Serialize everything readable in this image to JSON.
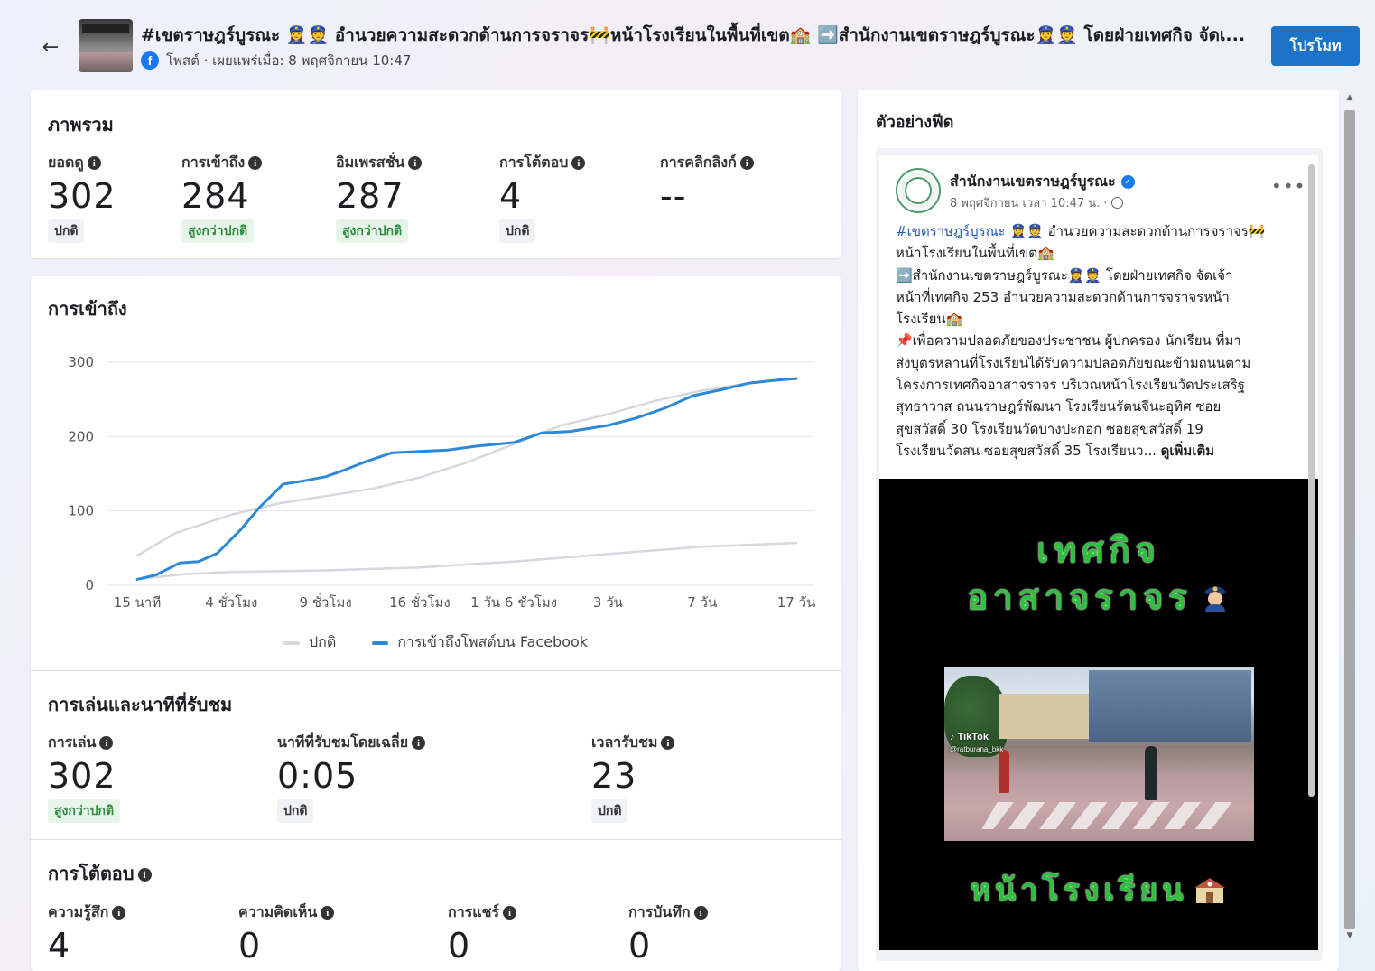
{
  "header": {
    "post_title": "#เขตราษฎร์บูรณะ 👮‍♀️👮 อำนวยความสะดวกด้านการจราจร🚧หน้าโรงเรียนในพื้นที่เขต🏫 ➡️สำนักงานเขตราษฎร์บูรณะ👮‍♀️👮 โดยฝ่ายเทศกิจ จัดเ...",
    "meta": "โพสต์ · เผยแพร่เมื่อ: 8 พฤศจิกายน 10:47",
    "promote_label": "โปรโมท"
  },
  "overview": {
    "title": "ภาพรวม",
    "metrics": [
      {
        "label": "ยอดดู",
        "value": "302",
        "badge": "ปกติ"
      },
      {
        "label": "การเข้าถึง",
        "value": "284",
        "badge": "สูงกว่าปกติ"
      },
      {
        "label": "อิมเพรสชั่น",
        "value": "287",
        "badge": "สูงกว่าปกติ"
      },
      {
        "label": "การโต้ตอบ",
        "value": "4",
        "badge": "ปกติ"
      },
      {
        "label": "การคลิกลิงก์",
        "value": "--",
        "badge": ""
      }
    ]
  },
  "reach": {
    "title": "การเข้าถึง"
  },
  "chart_data": {
    "type": "line",
    "title": "",
    "xlabel": "",
    "ylabel": "",
    "ylim": [
      0,
      300
    ],
    "yticks": [
      "0",
      "100",
      "200",
      "300"
    ],
    "categories": [
      "15 นาที",
      "4 ชั่วโมง",
      "9 ชั่วโมง",
      "16 ชั่วโมง",
      "1 วัน 6 ชั่วโมง",
      "3 วัน",
      "7 วัน",
      "17 วัน"
    ],
    "grid": true,
    "legend_position": "bottom",
    "series": [
      {
        "name": "ปกติ (upper)",
        "color": "#d5d8dc",
        "x": [
          0,
          0.4,
          1,
          1.5,
          2,
          2.5,
          3,
          3.5,
          4,
          4.5,
          5,
          5.5,
          6,
          6.5,
          7
        ],
        "values": [
          40,
          70,
          95,
          110,
          120,
          130,
          145,
          165,
          190,
          215,
          230,
          248,
          262,
          272,
          278
        ]
      },
      {
        "name": "ปกติ (lower)",
        "color": "#d5d8dc",
        "x": [
          0,
          0.5,
          1,
          2,
          3,
          4,
          5,
          6,
          7
        ],
        "values": [
          8,
          15,
          18,
          20,
          24,
          32,
          42,
          52,
          57
        ]
      },
      {
        "name": "การเข้าถึงโพสต์บน Facebook",
        "color": "#2d88d8",
        "x": [
          0,
          0.2,
          0.45,
          0.65,
          0.85,
          1.1,
          1.3,
          1.55,
          1.75,
          2,
          2.2,
          2.4,
          2.7,
          3,
          3.3,
          3.6,
          4,
          4.3,
          4.6,
          5,
          5.3,
          5.6,
          5.9,
          6.2,
          6.5,
          6.8,
          7
        ],
        "values": [
          8,
          14,
          30,
          32,
          43,
          75,
          105,
          136,
          140,
          146,
          155,
          165,
          178,
          180,
          182,
          187,
          192,
          205,
          207,
          215,
          225,
          238,
          255,
          263,
          272,
          276,
          278
        ]
      }
    ]
  },
  "legend": {
    "normal": "ปกติ",
    "reach": "การเข้าถึงโพสต์บน Facebook"
  },
  "playback": {
    "title": "การเล่นและนาทีที่รับชม",
    "metrics": [
      {
        "label": "การเล่น",
        "value": "302",
        "badge": "สูงกว่าปกติ"
      },
      {
        "label": "นาทีที่รับชมโดยเฉลี่ย",
        "value": "0:05",
        "badge": "ปกติ"
      },
      {
        "label": "เวลารับชม",
        "value": "23",
        "badge": "ปกติ"
      }
    ]
  },
  "engagement": {
    "title": "การโต้ตอบ",
    "metrics": [
      {
        "label": "ความรู้สึก",
        "value": "4"
      },
      {
        "label": "ความคิดเห็น",
        "value": "0"
      },
      {
        "label": "การแชร์",
        "value": "0"
      },
      {
        "label": "การบันทึก",
        "value": "0"
      }
    ]
  },
  "preview": {
    "title": "ตัวอย่างฟีด",
    "page_name": "สำนักงานเขตราษฎร์บูรณะ",
    "post_date": "8 พฤศจิกายน เวลา 10:47 น. ·",
    "lines": [
      "หน้าโรงเรียนในพื้นที่เขต🏫",
      "➡️สำนักงานเขตราษฎร์บูรณะ👮‍♀️👮 โดยฝ่ายเทศกิจ จัดเจ้า",
      "หน้าที่เทศกิจ 253 อำนวยความสะดวกด้านการจราจรหน้า",
      "โรงเรียน🏫",
      "📌เพื่อความปลอดภัยของประชาชน ผู้ปกครอง นักเรียน ที่มา",
      "ส่งบุตรหลานที่โรงเรียนได้รับความปลอดภัยขณะข้ามถนนตาม",
      "โครงการเทศกิจอาสาจราจร บริเวณหน้าโรงเรียนวัดประเสริฐ",
      "สุทธาวาส ถนนราษฎร์พัฒนา โรงเรียนรัตนจีนะอุทิศ ซอย",
      "สุขสวัสดิ์ 30 โรงเรียนวัดบางปะกอก ซอยสุขสวัสดิ์ 19"
    ],
    "hashtag": "#เขตราษฎร์บูรณะ",
    "first_line_rest": " 👮‍♀️👮 อำนวยความสะดวกด้านการจราจร🚧",
    "last_line": "โรงเรียนวัดสน ซอยสุขสวัสดิ์ 35 โรงเรียนว...",
    "see_more": "ดูเพิ่มเติม",
    "video_title1": "เทศกิจ",
    "video_title2": "อาสาจราจร",
    "video_title3": "หน้าโรงเรียน",
    "tiktok_brand": "TikTok",
    "tiktok_handle": "@ratburana_bkk"
  }
}
